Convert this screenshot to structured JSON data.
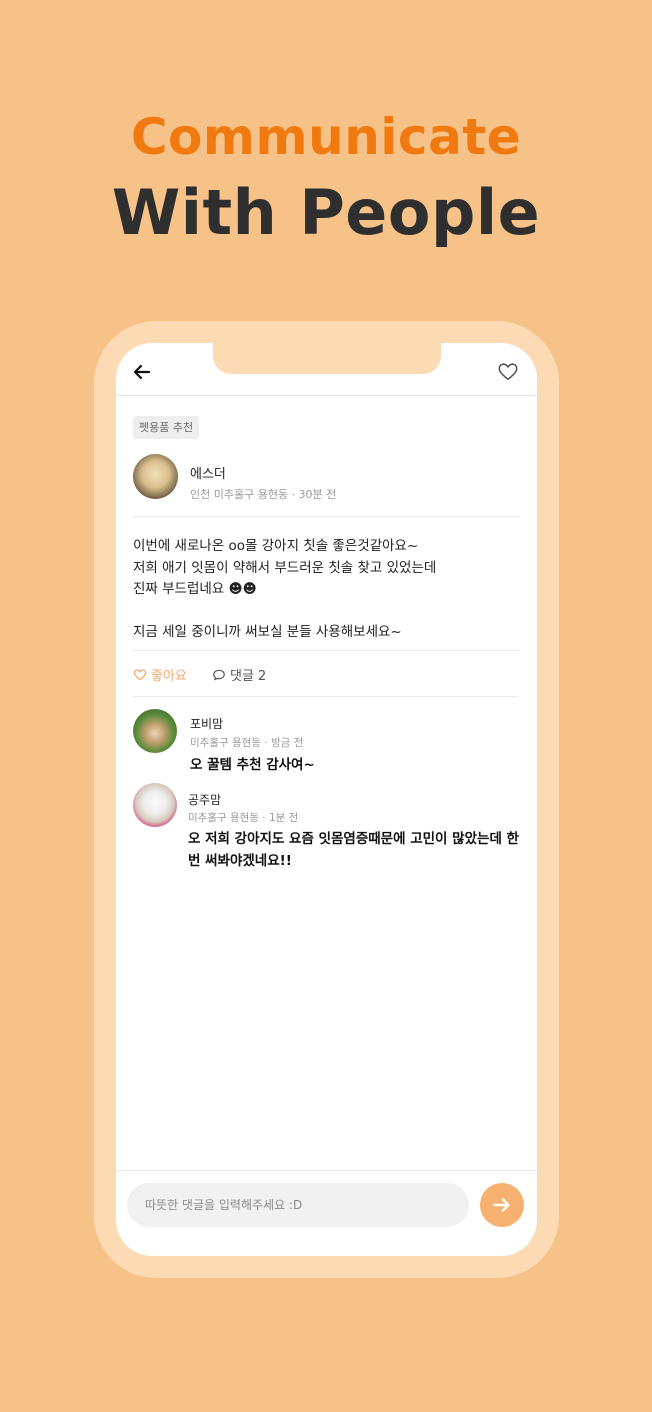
{
  "promo": {
    "line1": "Communicate",
    "line2": "With People"
  },
  "post": {
    "category": "펫용품 추천",
    "author": {
      "name": "에스더",
      "meta": "인천 미추홀구 용현동 · 30분 전"
    },
    "body_lines": [
      "이번에 새로나온 oo몰 강아지 칫솔 좋은것같아요~",
      "저희 애기 잇몸이 약해서 부드러운 칫솔 찾고 있었는데",
      "진짜 부드럽네요 ☻☻",
      "지금 세일 중이니까 써보실 분들 사용해보세요~"
    ],
    "like_label": "좋아요",
    "comment_label": "댓글 2"
  },
  "comments": [
    {
      "name": "포비맘",
      "meta": "미추홀구 용현동 · 방금 전",
      "text": "오 꿀템 추천 감사여~"
    },
    {
      "name": "공주맘",
      "meta": "미추홀구 용현동 · 1분 전",
      "text": "오 저희 강아지도 요즘 잇몸염증때문에 고민이 많았는데 한번 써봐야겠네요!!"
    }
  ],
  "composer": {
    "placeholder": "따뜻한 댓글을 입력해주세요 :D"
  },
  "colors": {
    "background": "#f6c288",
    "accent_orange": "#f07a10",
    "like_orange": "#f5a96b",
    "send_button": "#f6b070"
  },
  "icons": {
    "back": "back-arrow-icon",
    "favorite": "heart-outline-icon",
    "like": "heart-outline-icon",
    "comment": "speech-bubble-icon",
    "send": "arrow-right-icon"
  }
}
